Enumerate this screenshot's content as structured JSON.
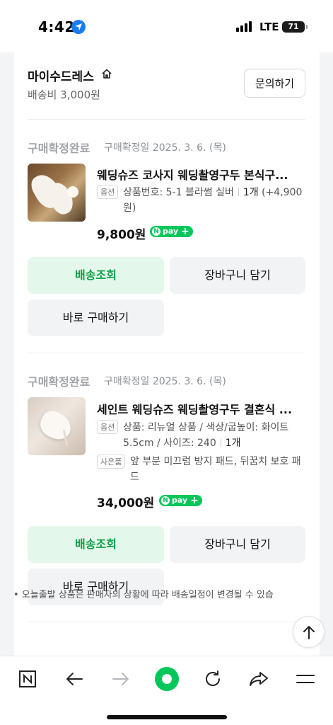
{
  "status_bar": {
    "time": "4:42",
    "network": "LTE",
    "battery": "71"
  },
  "store": {
    "name": "마이수드레스",
    "shipping_fee": "배송비 3,000원",
    "inquiry_label": "문의하기"
  },
  "orders": [
    {
      "status": "구매확정완료",
      "confirm_date": "구매확정일 2025. 3. 6. (목)",
      "title": "웨딩슈즈 코사지 웨딩촬영구두 본식구...",
      "option_tag": "옵션",
      "option_text": "상품번호: 5-1 블라썸 실버",
      "quantity": "1개",
      "extra_price": "(+4,900원)",
      "price": "9,800원",
      "npay_label": "pay",
      "track_label": "배송조회",
      "cart_label": "장바구니 담기",
      "buy_label": "바로 구매하기"
    },
    {
      "status": "구매확정완료",
      "confirm_date": "구매확정일 2025. 3. 6. (목)",
      "title": "세인트 웨딩슈즈 웨딩촬영구두 결혼식 ...",
      "option_tag": "옵션",
      "option_text": "상품: 리뉴얼 상품 / 색상/굽높이: 화이트 5.5cm / 사이즈: 240",
      "quantity": "1개",
      "gift_tag": "사은품",
      "gift_text": "앞 부분 미끄럼 방지 패드, 뒤꿈치 보호 패드",
      "price": "34,000원",
      "npay_label": "pay",
      "track_label": "배송조회",
      "cart_label": "장바구니 담기",
      "buy_label": "바로 구매하기"
    }
  ],
  "notice": "• 오늘출발 상품은 판매자의 상황에 따라 배송일정이 변경될 수 있습",
  "bottom_nav": [
    "naver-home",
    "back",
    "forward",
    "green-dot",
    "refresh",
    "share",
    "menu"
  ],
  "colors": {
    "accent_green": "#03c75a",
    "track_button_bg": "#e3f8ea",
    "track_button_text": "#0b9f47"
  }
}
